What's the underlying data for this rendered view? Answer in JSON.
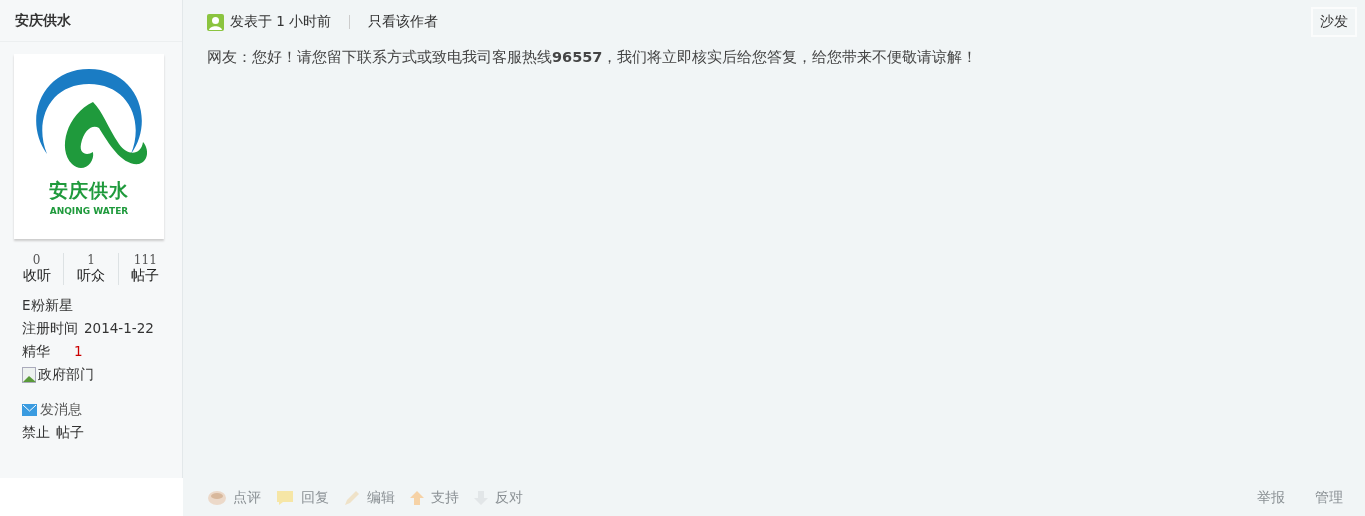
{
  "sidebar": {
    "username": "安庆供水",
    "avatar": {
      "title": "安庆供水",
      "subtitle": "ANQING WATER"
    },
    "stats": [
      {
        "value": "0",
        "label": "收听"
      },
      {
        "value": "1",
        "label": "听众"
      },
      {
        "value": "111",
        "label": "帖子"
      }
    ],
    "rank": "E粉新星",
    "info": [
      {
        "label": "注册时间",
        "value": "2014-1-22",
        "kind": "plain"
      },
      {
        "label": "精华",
        "value": "1",
        "kind": "highlight"
      }
    ],
    "group_image_alt": "政府部门",
    "message_link": "发消息",
    "ban_links": [
      "禁止",
      "帖子"
    ]
  },
  "post": {
    "posted": "发表于 1 小时前",
    "author_only": "只看该作者",
    "floor": "沙发",
    "body": "网友：您好！请您留下联系方式或致电我司客服热线**96557**，我们将立即核实后给您答复，给您带来不便敬请谅解！",
    "actions": [
      {
        "kind": "comment",
        "label": "点评"
      },
      {
        "kind": "reply",
        "label": "回复"
      },
      {
        "kind": "edit",
        "label": "编辑"
      },
      {
        "kind": "up",
        "label": "支持"
      },
      {
        "kind": "down",
        "label": "反对"
      }
    ],
    "right_actions": [
      "举报",
      "管理"
    ]
  }
}
